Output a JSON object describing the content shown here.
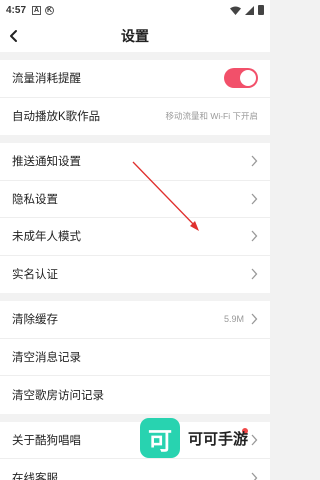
{
  "status_bar": {
    "time": "4:57",
    "icon_a": "A",
    "icon_k": "K"
  },
  "header": {
    "title": "设置"
  },
  "group1": [
    {
      "label": "流量消耗提醒",
      "toggle": true
    },
    {
      "label": "自动播放K歌作品",
      "hint": "移动流量和 Wi-Fi 下开启"
    }
  ],
  "group2": [
    {
      "label": "推送通知设置"
    },
    {
      "label": "隐私设置"
    },
    {
      "label": "未成年人模式"
    },
    {
      "label": "实名认证"
    }
  ],
  "group3": [
    {
      "label": "清除缓存",
      "value": "5.9M"
    },
    {
      "label": "清空消息记录"
    },
    {
      "label": "清空歌房访问记录"
    }
  ],
  "group4": [
    {
      "label": "关于酷狗唱唱"
    },
    {
      "label": "在线客服"
    }
  ],
  "watermark": {
    "logo_char": "可",
    "text": "可可手游"
  },
  "colors": {
    "toggle_on": "#f2506a",
    "watermark_logo": "#28d3b0",
    "annotation_arrow": "#e0302e"
  }
}
